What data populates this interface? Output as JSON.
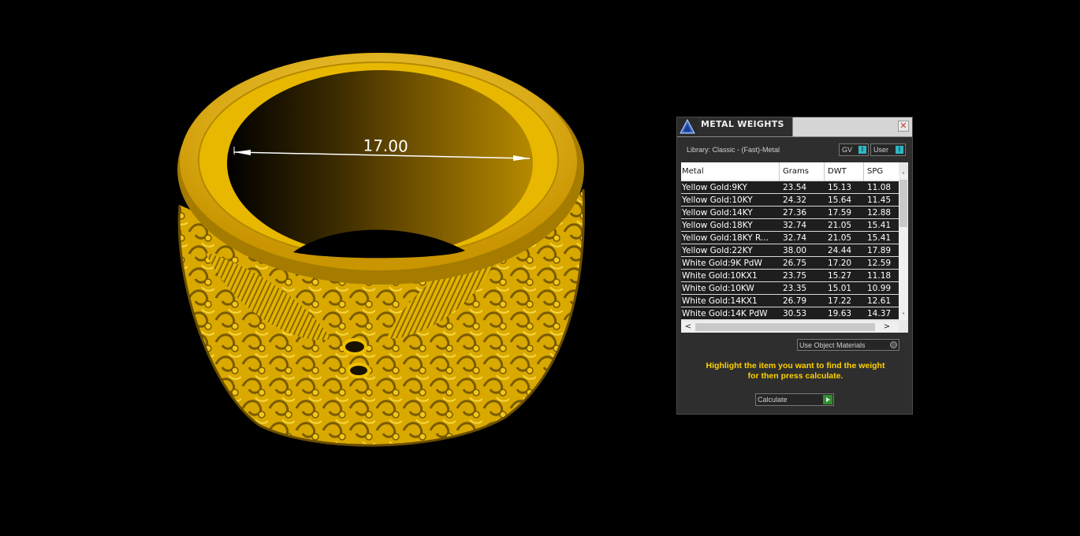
{
  "viewport": {
    "dimension_label": "17.00"
  },
  "panel": {
    "title": "METAL WEIGHTS",
    "close_icon": "close-icon",
    "library_label": "Library: Classic - (Fast)-Metal",
    "gv_label": "GV",
    "user_label": "User",
    "toggle_glyph": "I",
    "columns": [
      "Metal",
      "Grams",
      "DWT",
      "SPG"
    ],
    "rows": [
      {
        "metal": "Yellow Gold:9KY",
        "grams": "23.54",
        "dwt": "15.13",
        "spg": "11.08"
      },
      {
        "metal": "Yellow Gold:10KY",
        "grams": "24.32",
        "dwt": "15.64",
        "spg": "11.45"
      },
      {
        "metal": "Yellow Gold:14KY",
        "grams": "27.36",
        "dwt": "17.59",
        "spg": "12.88"
      },
      {
        "metal": "Yellow Gold:18KY",
        "grams": "32.74",
        "dwt": "21.05",
        "spg": "15.41"
      },
      {
        "metal": "Yellow Gold:18KY R...",
        "grams": "32.74",
        "dwt": "21.05",
        "spg": "15.41"
      },
      {
        "metal": "Yellow Gold:22KY",
        "grams": "38.00",
        "dwt": "24.44",
        "spg": "17.89"
      },
      {
        "metal": "White Gold:9K PdW",
        "grams": "26.75",
        "dwt": "17.20",
        "spg": "12.59"
      },
      {
        "metal": "White Gold:10KX1",
        "grams": "23.75",
        "dwt": "15.27",
        "spg": "11.18"
      },
      {
        "metal": "White Gold:10KW",
        "grams": "23.35",
        "dwt": "15.01",
        "spg": "10.99"
      },
      {
        "metal": "White Gold:14KX1",
        "grams": "26.79",
        "dwt": "17.22",
        "spg": "12.61"
      },
      {
        "metal": "White Gold:14K PdW",
        "grams": "30.53",
        "dwt": "19.63",
        "spg": "14.37"
      }
    ],
    "use_object_materials_label": "Use Object Materials",
    "hint_line1": "Highlight the item you want to find the weight",
    "hint_line2": "for then press calculate.",
    "calculate_label": "Calculate",
    "scroll_up": "˄",
    "scroll_down": "˅",
    "scroll_left": "<",
    "scroll_right": ">"
  },
  "colors": {
    "gold": "#e6b400",
    "hint_yellow": "#ffd200",
    "toggle_accent": "#30b7c2",
    "calc_green": "#2f8f2f"
  }
}
